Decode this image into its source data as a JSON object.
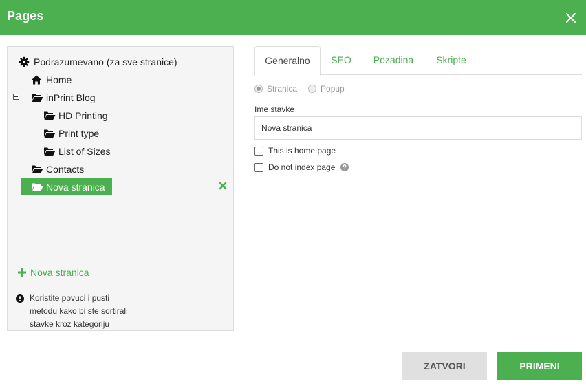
{
  "dialog": {
    "title": "Pages"
  },
  "tree": {
    "items": [
      {
        "label": "Podrazumevano (za sve stranice)",
        "icon": "gear-icon"
      },
      {
        "label": "Home",
        "icon": "home-icon"
      },
      {
        "label": "inPrint Blog",
        "icon": "folder-open-icon"
      },
      {
        "label": "HD Printing",
        "icon": "folder-open-icon"
      },
      {
        "label": "Print type",
        "icon": "folder-open-icon"
      },
      {
        "label": "List of Sizes",
        "icon": "folder-open-icon"
      },
      {
        "label": "Contacts",
        "icon": "folder-open-icon"
      },
      {
        "label": "Nova stranica",
        "icon": "folder-open-icon",
        "selected": true
      }
    ],
    "add_label": "Nova stranica",
    "hint": "Koristite povuci i pusti metodu kako bi ste sortirali stavke kroz kategoriju"
  },
  "tabs": [
    {
      "label": "Generalno",
      "active": true
    },
    {
      "label": "SEO"
    },
    {
      "label": "Pozadina"
    },
    {
      "label": "Skripte"
    }
  ],
  "form": {
    "type_options": [
      {
        "label": "Stranica",
        "checked": true
      },
      {
        "label": "Popup",
        "checked": false
      }
    ],
    "name_label": "Ime stavke",
    "name_value": "Nova stranica",
    "home_page_label": "This is home page",
    "no_index_label": "Do not index page"
  },
  "buttons": {
    "close": "ZATVORI",
    "apply": "PRIMENI"
  },
  "colors": {
    "accent": "#4caf50",
    "panel_bg": "#f5f5f5",
    "close_button_bg": "#e0e0e0"
  }
}
